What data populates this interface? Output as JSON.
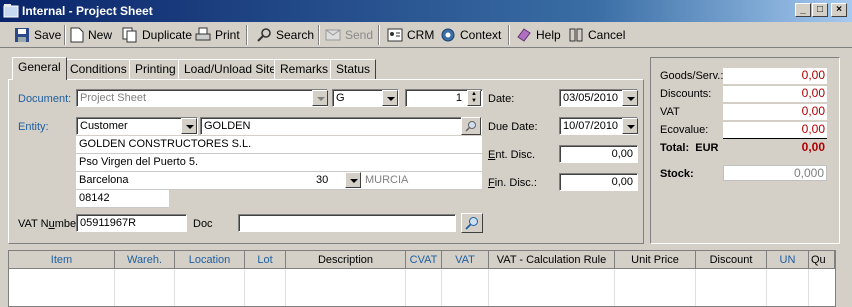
{
  "window": {
    "title": "Internal - Project Sheet"
  },
  "toolbar": {
    "save": "Save",
    "new": "New",
    "duplicate": "Duplicate",
    "print": "Print",
    "search": "Search",
    "send": "Send",
    "crm": "CRM",
    "context": "Context",
    "help": "Help",
    "cancel": "Cancel"
  },
  "tabs": [
    "General",
    "Conditions",
    "Printing",
    "Load/Unload Site",
    "Remarks",
    "Status"
  ],
  "form": {
    "document_label": "Document:",
    "document_value": "Project Sheet",
    "series_value": "G",
    "number_value": "1",
    "entity_label": "Entity:",
    "entity_type": "Customer",
    "entity_code": "GOLDEN",
    "entity_name": "GOLDEN CONSTRUCTORES S.L.",
    "address": "Pso Virgen del Puerto 5.",
    "city": "Barcelona",
    "province_code": "30",
    "province_name": "MURCIA",
    "zip": "08142",
    "vat_label_pre": "VAT N",
    "vat_label_u": "u",
    "vat_label_post": "mber",
    "vat_value": "05911967R",
    "doc_label": "Doc",
    "doc_value": "",
    "date_label": "Date:",
    "date_value": "03/05/2010",
    "due_date_label": "Due Date:",
    "due_date_value": "10/07/2010",
    "ent_disc_u": "E",
    "ent_disc_rest": "nt. Disc.",
    "ent_disc_value": "0,00",
    "fin_disc_u": "F",
    "fin_disc_rest": "in. Disc.:",
    "fin_disc_value": "0,00"
  },
  "totals": {
    "goods_label": "Goods/Serv.:",
    "goods_value": "0,00",
    "discounts_label": "Discounts:",
    "discounts_value": "0,00",
    "vat_label": "VAT",
    "vat_value": "0,00",
    "ecovalue_label": "Ecovalue:",
    "ecovalue_value": "0,00",
    "total_label": "Total:",
    "currency": "EUR",
    "total_value": "0,00",
    "stock_label": "Stock:",
    "stock_value": "0,000"
  },
  "grid": {
    "columns": [
      "Item",
      "Wareh.",
      "Location",
      "Lot",
      "Description",
      "CVAT",
      "VAT",
      "VAT - Calculation Rule",
      "Unit Price",
      "Discount",
      "UN",
      "Qu"
    ]
  },
  "colors": {
    "accent_blue": "#1f5fa0",
    "total_red": "#b00000",
    "titlebar": "#0a246a"
  }
}
